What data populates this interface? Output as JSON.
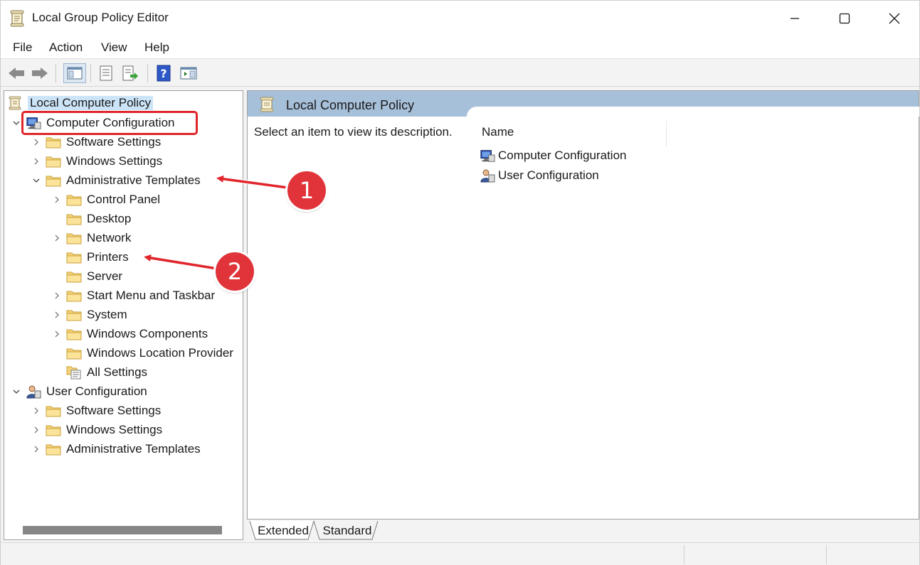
{
  "window": {
    "title": "Local Group Policy Editor"
  },
  "menu": [
    "File",
    "Action",
    "View",
    "Help"
  ],
  "toolbar_icons": [
    "back-arrow-icon",
    "forward-arrow-icon",
    "show-hide-console-tree-icon",
    "properties-icon",
    "export-list-icon",
    "help-icon",
    "show-action-pane-icon"
  ],
  "tree": {
    "root": "Local Computer Policy",
    "computer_config": "Computer Configuration",
    "cc_software": "Software Settings",
    "cc_windows": "Windows Settings",
    "cc_admin": "Administrative Templates",
    "admin_children": [
      "Control Panel",
      "Desktop",
      "Network",
      "Printers",
      "Server",
      "Start Menu and Taskbar",
      "System",
      "Windows Components",
      "Windows Location Provider",
      "All Settings"
    ],
    "user_config": "User Configuration",
    "uc_software": "Software Settings",
    "uc_windows": "Windows Settings",
    "uc_admin": "Administrative Templates"
  },
  "right_pane": {
    "header_title": "Local Computer Policy",
    "description": "Select an item to view its description.",
    "column_name": "Name",
    "items": [
      "Computer Configuration",
      "User Configuration"
    ]
  },
  "tabs": {
    "extended": "Extended",
    "standard": "Standard"
  },
  "annotations": {
    "badge1": "1",
    "badge2": "2",
    "color": "#e0252b"
  }
}
